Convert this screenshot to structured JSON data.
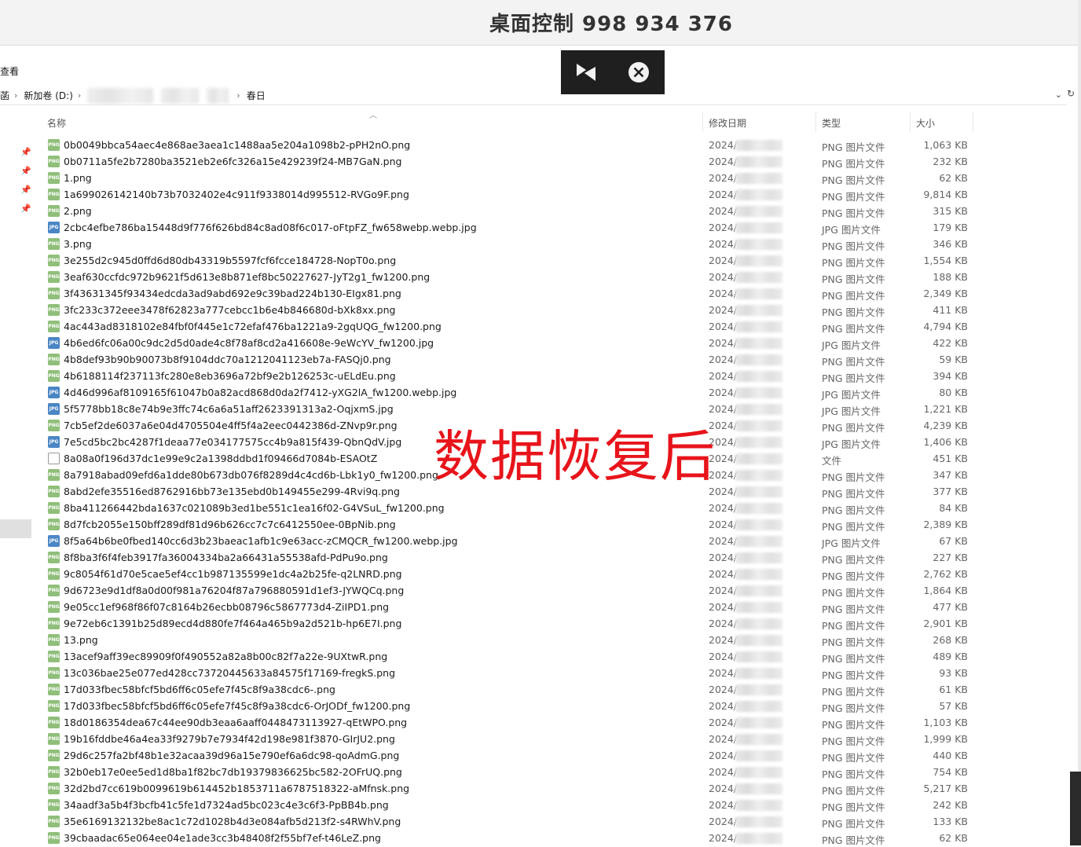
{
  "window": {
    "title": "桌面控制 998 934 376"
  },
  "remote_toolbar": {
    "collapse_icon": "collapse-icon",
    "close_icon": "close-circle-icon"
  },
  "menu": {
    "view": "查看"
  },
  "address": {
    "prefix": "菡",
    "drive": "新加卷 (D:)",
    "folder": "春日"
  },
  "columns": {
    "name": "名称",
    "date": "修改日期",
    "type": "类型",
    "size": "大小"
  },
  "overlay_text": "数据恢复后",
  "files": [
    {
      "name": "0b0049bbca54aec4e868ae3aea1c1488aa5e204a1098b2-pPH2nO.png",
      "date": "2024/",
      "type": "PNG 图片文件",
      "size": "1,063 KB",
      "kind": "png"
    },
    {
      "name": "0b0711a5fe2b7280ba3521eb2e6fc326a15e429239f24-MB7GaN.png",
      "date": "2024/",
      "type": "PNG 图片文件",
      "size": "232 KB",
      "kind": "png"
    },
    {
      "name": "1.png",
      "date": "2024/",
      "type": "PNG 图片文件",
      "size": "62 KB",
      "kind": "png"
    },
    {
      "name": "1a699026142140b73b7032402e4c911f9338014d995512-RVGo9F.png",
      "date": "2024/",
      "type": "PNG 图片文件",
      "size": "9,814 KB",
      "kind": "png"
    },
    {
      "name": "2.png",
      "date": "2024/",
      "type": "PNG 图片文件",
      "size": "315 KB",
      "kind": "png"
    },
    {
      "name": "2cbc4efbe786ba15448d9f776f626bd84c8ad08f6c017-oFtpFZ_fw658webp.webp.jpg",
      "date": "2024/",
      "type": "JPG 图片文件",
      "size": "179 KB",
      "kind": "jpg"
    },
    {
      "name": "3.png",
      "date": "2024/",
      "type": "PNG 图片文件",
      "size": "346 KB",
      "kind": "png"
    },
    {
      "name": "3e255d2c945d0ffd6d80db43319b5597fcf6fcce184728-NopT0o.png",
      "date": "2024/",
      "type": "PNG 图片文件",
      "size": "1,554 KB",
      "kind": "png"
    },
    {
      "name": "3eaf630ccfdc972b9621f5d613e8b871ef8bc50227627-JyT2g1_fw1200.png",
      "date": "2024/",
      "type": "PNG 图片文件",
      "size": "188 KB",
      "kind": "png"
    },
    {
      "name": "3f43631345f93434edcda3ad9abd692e9c39bad224b130-EIgx81.png",
      "date": "2024/",
      "type": "PNG 图片文件",
      "size": "2,349 KB",
      "kind": "png"
    },
    {
      "name": "3fc233c372eee3478f62823a777cebcc1b6e4b846680d-bXk8xx.png",
      "date": "2024/",
      "type": "PNG 图片文件",
      "size": "411 KB",
      "kind": "png"
    },
    {
      "name": "4ac443ad8318102e84fbf0f445e1c72efaf476ba1221a9-2gqUQG_fw1200.png",
      "date": "2024/",
      "type": "PNG 图片文件",
      "size": "4,794 KB",
      "kind": "png"
    },
    {
      "name": "4b6ed6fc06a00c9dc2d5d0ade4c8f78af8cd2a416608e-9eWcYV_fw1200.jpg",
      "date": "2024/",
      "type": "JPG 图片文件",
      "size": "422 KB",
      "kind": "jpg"
    },
    {
      "name": "4b8def93b90b90073b8f9104ddc70a1212041123eb7a-FASQj0.png",
      "date": "2024/",
      "type": "PNG 图片文件",
      "size": "59 KB",
      "kind": "png"
    },
    {
      "name": "4b6188114f237113fc280e8eb3696a72bf9e2b126253c-uELdEu.png",
      "date": "2024/",
      "type": "PNG 图片文件",
      "size": "394 KB",
      "kind": "png"
    },
    {
      "name": "4d46d996af8109165f61047b0a82acd868d0da2f7412-yXG2lA_fw1200.webp.jpg",
      "date": "2024/",
      "type": "JPG 图片文件",
      "size": "80 KB",
      "kind": "jpg"
    },
    {
      "name": "5f5778bb18c8e74b9e3ffc74c6a6a51aff2623391313a2-OqjxmS.jpg",
      "date": "2024/",
      "type": "JPG 图片文件",
      "size": "1,221 KB",
      "kind": "jpg"
    },
    {
      "name": "7cb5ef2de6037a6e04d4705504e4ff5f4a2eec0442386d-ZNvp9r.png",
      "date": "2024/",
      "type": "PNG 图片文件",
      "size": "4,239 KB",
      "kind": "png"
    },
    {
      "name": "7e5cd5bc2bc4287f1deaa77e034177575cc4b9a815f439-QbnQdV.jpg",
      "date": "2024/",
      "type": "JPG 图片文件",
      "size": "1,406 KB",
      "kind": "jpg"
    },
    {
      "name": "8a08a0f196d37dc1e99e9c2a1398ddbd1f09466d7084b-ESAOtZ",
      "date": "2024/",
      "type": "文件",
      "size": "451 KB",
      "kind": "file"
    },
    {
      "name": "8a7918abad09efd6a1dde80b673db076f8289d4c4cd6b-Lbk1y0_fw1200.png",
      "date": "2024/",
      "type": "PNG 图片文件",
      "size": "347 KB",
      "kind": "png"
    },
    {
      "name": "8abd2efe35516ed8762916bb73e135ebd0b149455e299-4Rvi9q.png",
      "date": "2024/",
      "type": "PNG 图片文件",
      "size": "377 KB",
      "kind": "png"
    },
    {
      "name": "8ba411266442bda1637c021089b3ed1be551c1ea16f02-G4VSuL_fw1200.png",
      "date": "2024/",
      "type": "PNG 图片文件",
      "size": "84 KB",
      "kind": "png"
    },
    {
      "name": "8d7fcb2055e150bff289df81d96b626cc7c7c6412550ee-0BpNib.png",
      "date": "2024/",
      "type": "PNG 图片文件",
      "size": "2,389 KB",
      "kind": "png"
    },
    {
      "name": "8f5a64b6be0fbed140cc6d3b23baeac1afb1c9e63acc-zCMQCR_fw1200.webp.jpg",
      "date": "2024/",
      "type": "JPG 图片文件",
      "size": "67 KB",
      "kind": "jpg"
    },
    {
      "name": "8f8ba3f6f4feb3917fa36004334ba2a66431a55538afd-PdPu9o.png",
      "date": "2024/",
      "type": "PNG 图片文件",
      "size": "227 KB",
      "kind": "png"
    },
    {
      "name": "9c8054f61d70e5cae5ef4cc1b987135599e1dc4a2b25fe-q2LNRD.png",
      "date": "2024/",
      "type": "PNG 图片文件",
      "size": "2,762 KB",
      "kind": "png"
    },
    {
      "name": "9d6723e9d1df8a0d00f981a76204f87a796880591d1ef3-JYWQCq.png",
      "date": "2024/",
      "type": "PNG 图片文件",
      "size": "1,864 KB",
      "kind": "png"
    },
    {
      "name": "9e05cc1ef968f86f07c8164b26ecbb08796c5867773d4-ZiIPD1.png",
      "date": "2024/",
      "type": "PNG 图片文件",
      "size": "477 KB",
      "kind": "png"
    },
    {
      "name": "9e72eb6c1391b25d89ecd4d880fe7f464a465b9a2d521b-hp6E7I.png",
      "date": "2024/",
      "type": "PNG 图片文件",
      "size": "2,901 KB",
      "kind": "png"
    },
    {
      "name": "13.png",
      "date": "2024/",
      "type": "PNG 图片文件",
      "size": "268 KB",
      "kind": "png"
    },
    {
      "name": "13acef9aff39ec89909f0f490552a82a8b00c82f7a22e-9UXtwR.png",
      "date": "2024/",
      "type": "PNG 图片文件",
      "size": "489 KB",
      "kind": "png"
    },
    {
      "name": "13c036bae25e077ed428cc73720445633a84575f17169-fregkS.png",
      "date": "2024/",
      "type": "PNG 图片文件",
      "size": "93 KB",
      "kind": "png"
    },
    {
      "name": "17d033fbec58bfcf5bd6ff6c05efe7f45c8f9a38cdc6-.png",
      "date": "2024/",
      "type": "PNG 图片文件",
      "size": "61 KB",
      "kind": "png"
    },
    {
      "name": "17d033fbec58bfcf5bd6ff6c05efe7f45c8f9a38cdc6-OrJODf_fw1200.png",
      "date": "2024/",
      "type": "PNG 图片文件",
      "size": "57 KB",
      "kind": "png"
    },
    {
      "name": "18d0186354dea67c44ee90db3eaa6aaff0448473113927-qEtWPO.png",
      "date": "2024/",
      "type": "PNG 图片文件",
      "size": "1,103 KB",
      "kind": "png"
    },
    {
      "name": "19b16fddbe46a4ea33f9279b7e7934f42d198e981f3870-GIrJU2.png",
      "date": "2024/",
      "type": "PNG 图片文件",
      "size": "1,999 KB",
      "kind": "png"
    },
    {
      "name": "29d6c257fa2bf48b1e32acaa39d96a15e790ef6a6dc98-qoAdmG.png",
      "date": "2024/",
      "type": "PNG 图片文件",
      "size": "440 KB",
      "kind": "png"
    },
    {
      "name": "32b0eb17e0ee5ed1d8ba1f82bc7db19379836625bc582-2OFrUQ.png",
      "date": "2024/",
      "type": "PNG 图片文件",
      "size": "754 KB",
      "kind": "png"
    },
    {
      "name": "32d2bd7cc619b0099619b614452b1853711a6787518322-aMfnsk.png",
      "date": "2024/",
      "type": "PNG 图片文件",
      "size": "5,217 KB",
      "kind": "png"
    },
    {
      "name": "34aadf3a5b4f3bcfb41c5fe1d7324ad5bc023c4e3c6f3-PpBB4b.png",
      "date": "2024/",
      "type": "PNG 图片文件",
      "size": "242 KB",
      "kind": "png"
    },
    {
      "name": "35e6169132132be8ac1c72d1028b4d3e084afb5d213f2-s4RWhV.png",
      "date": "2024/",
      "type": "PNG 图片文件",
      "size": "133 KB",
      "kind": "png"
    },
    {
      "name": "39cbaadac65e064ee04e1ade3cc3b48408f2f55bf7ef-t46LeZ.png",
      "date": "2024/",
      "type": "PNG 图片文件",
      "size": "62 KB",
      "kind": "png"
    }
  ]
}
